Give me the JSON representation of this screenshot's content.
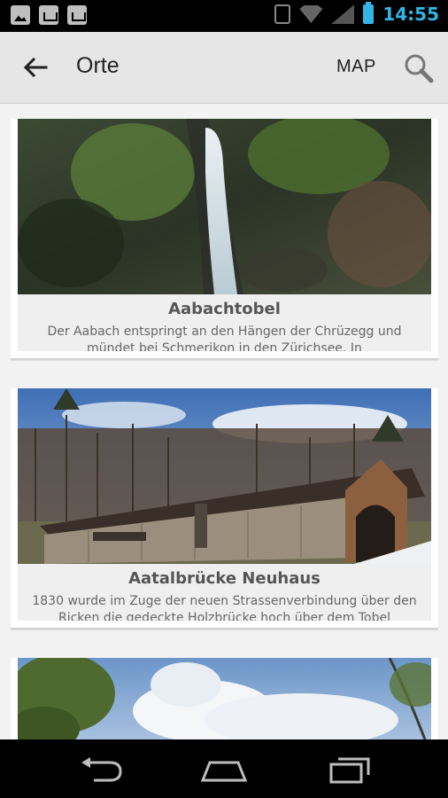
{
  "status_bar": {
    "time": "14:55",
    "icons": [
      "gallery-icon",
      "bag-icon",
      "bag-check-icon",
      "vibrate-icon",
      "wifi-icon",
      "signal-icon",
      "battery-icon"
    ],
    "accent_color": "#33b5e5"
  },
  "app_bar": {
    "title": "Orte",
    "map_label": "MAP",
    "icons": [
      "back-arrow-icon",
      "search-icon"
    ]
  },
  "places": [
    {
      "name": "Aabachtobel",
      "description": "Der Aabach entspringt an den Hängen der Chrüzegg und mündet bei Schmerikon in den Zürichsee. In",
      "image": "waterfall-photo"
    },
    {
      "name": "Aatalbrücke Neuhaus",
      "description": "1830 wurde im Zuge der  neuen Strassenverbindung über den Ricken die gedeckte Holzbrücke hoch über dem Tobel",
      "image": "covered-bridge-photo"
    },
    {
      "name": "",
      "description": "",
      "image": "sky-trees-photo"
    }
  ],
  "nav_bar": {
    "icons": [
      "back-nav-icon",
      "home-nav-icon",
      "recents-nav-icon"
    ]
  }
}
